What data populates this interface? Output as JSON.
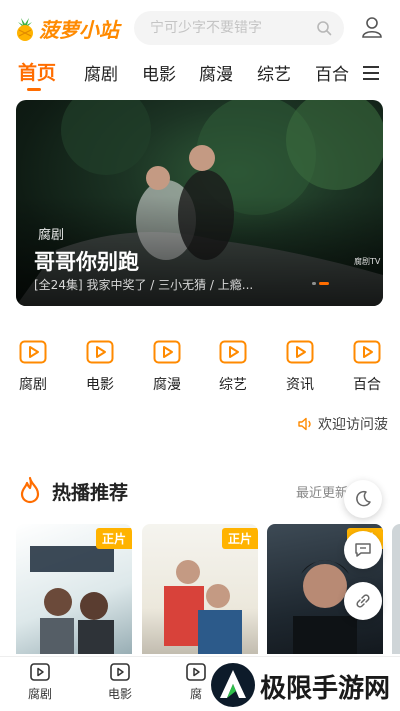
{
  "app": {
    "name": "菠萝小站"
  },
  "search": {
    "placeholder": "宁可少字不要错字"
  },
  "nav": {
    "items": [
      "首页",
      "腐剧",
      "电影",
      "腐漫",
      "综艺",
      "百合"
    ],
    "active": "首页"
  },
  "banner": {
    "tag": "腐剧",
    "title": "哥哥你别跑",
    "description": "[全24集] 我家中奖了 / 三小无猜 / 上瘾...",
    "watermark": "腐剧TV"
  },
  "quick_links": [
    "腐剧",
    "电影",
    "腐漫",
    "综艺",
    "资讯",
    "百合"
  ],
  "notice": {
    "text": "欢迎访问菠"
  },
  "section": {
    "title": "热播推荐",
    "more": "最近更新"
  },
  "cards": [
    {
      "badge": "正片"
    },
    {
      "badge": "正片"
    },
    {
      "badge": "正片"
    }
  ],
  "tabbar": [
    "腐剧",
    "电影",
    "腐"
  ],
  "brand": {
    "text": "极限手游网"
  },
  "colors": {
    "accent": "#ff6d00",
    "badge": "#ffb300"
  }
}
